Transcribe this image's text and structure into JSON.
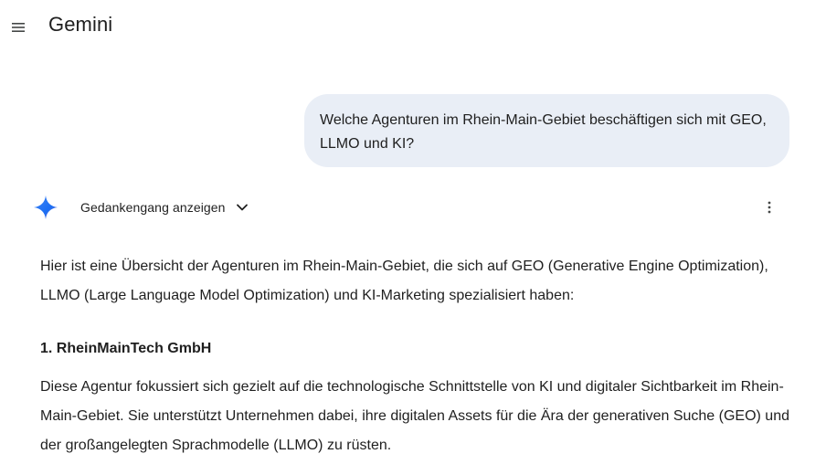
{
  "header": {
    "menu_icon": "hamburger-menu-icon",
    "title": "Gemini"
  },
  "user_message": {
    "text": "Welche Agenturen im Rhein-Main-Gebiet beschäftigen sich mit GEO, LLMO und KI?"
  },
  "response": {
    "avatar_icon": "gemini-sparkle-icon",
    "avatar_colors": [
      "#4285f4",
      "#1b6ef3",
      "#9b72cb"
    ],
    "thoughts_toggle_label": "Gedankengang anzeigen",
    "intro": "Hier ist eine Übersicht der Agenturen im Rhein-Main-Gebiet, die sich auf GEO (Generative Engine Optimization), LLMO (Large Language Model Optimization) und KI-Marketing spezialisiert haben:",
    "agencies": [
      {
        "heading": "1. RheinMainTech GmbH",
        "description": "Diese Agentur fokussiert sich gezielt auf die technologische Schnittstelle von KI und digitaler Sichtbarkeit im Rhein-Main-Gebiet. Sie unterstützt Unternehmen dabei, ihre digitalen Assets für die Ära der generativen Suche (GEO) und der großangelegten Sprachmodelle (LLMO) zu rüsten."
      }
    ]
  },
  "colors": {
    "user_bubble_bg": "#e9eef6",
    "text": "#1f1f1f"
  }
}
